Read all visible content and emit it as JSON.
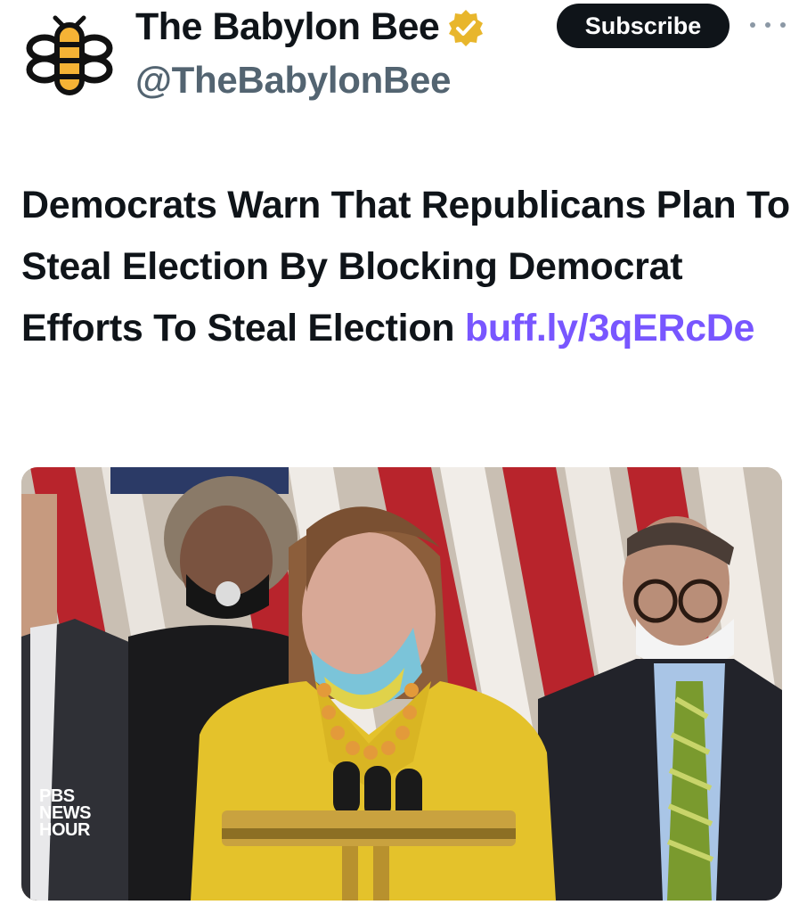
{
  "account": {
    "display_name": "The Babylon Bee",
    "handle": "@TheBabylonBee",
    "verified_icon": "gold-checkmark-badge",
    "logo_icon": "bee-logo"
  },
  "actions": {
    "subscribe_label": "Subscribe",
    "more_icon": "more-dots-icon"
  },
  "tweet": {
    "text": "Democrats Warn That Republicans Plan To Steal Election By Blocking Democrat Efforts To Steal Election",
    "link": "buff.ly/3qERcDe"
  },
  "media": {
    "watermark_line1": "PBS",
    "watermark_line2": "NEWS",
    "watermark_line3": "HOUR"
  },
  "colors": {
    "text": "#0f1419",
    "secondary": "#536471",
    "link": "#7856ff",
    "verified": "#e8b62c",
    "subscribe_bg": "#0f1419"
  }
}
